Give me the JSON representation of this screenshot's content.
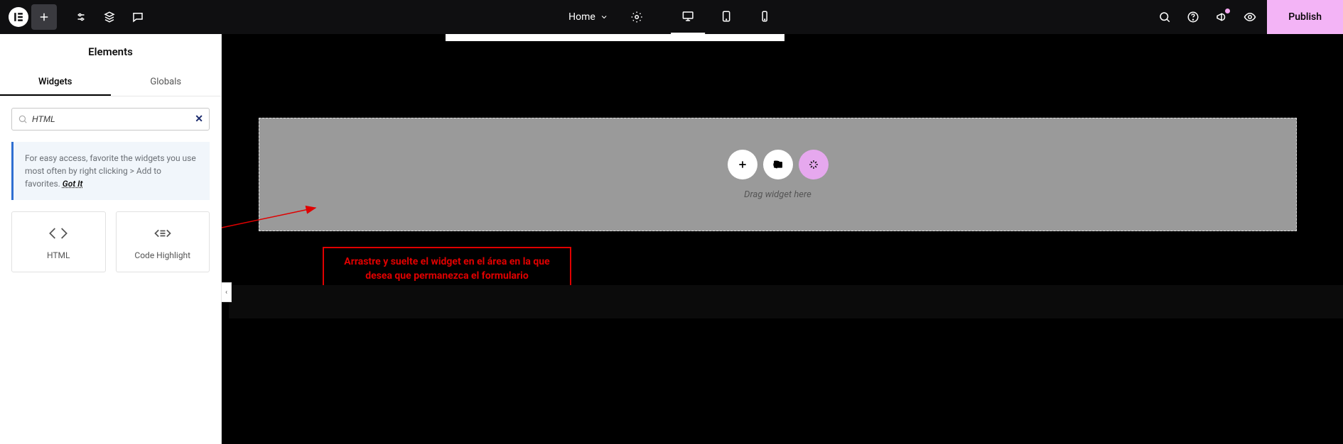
{
  "topbar": {
    "page_name": "Home",
    "publish_label": "Publish"
  },
  "sidebar": {
    "panel_title": "Elements",
    "tabs": {
      "widgets": "Widgets",
      "globals": "Globals"
    },
    "search_value": "HTML",
    "tip_text": "For easy access, favorite the widgets you use most often by right clicking > Add to favorites.",
    "tip_action": "Got It",
    "widgets": [
      {
        "label": "HTML"
      },
      {
        "label": "Code Highlight"
      }
    ]
  },
  "canvas": {
    "drop_hint": "Drag widget here"
  },
  "annotation": {
    "text": "Arrastre y suelte el widget en el área en la que desea que permanezca el formulario"
  }
}
